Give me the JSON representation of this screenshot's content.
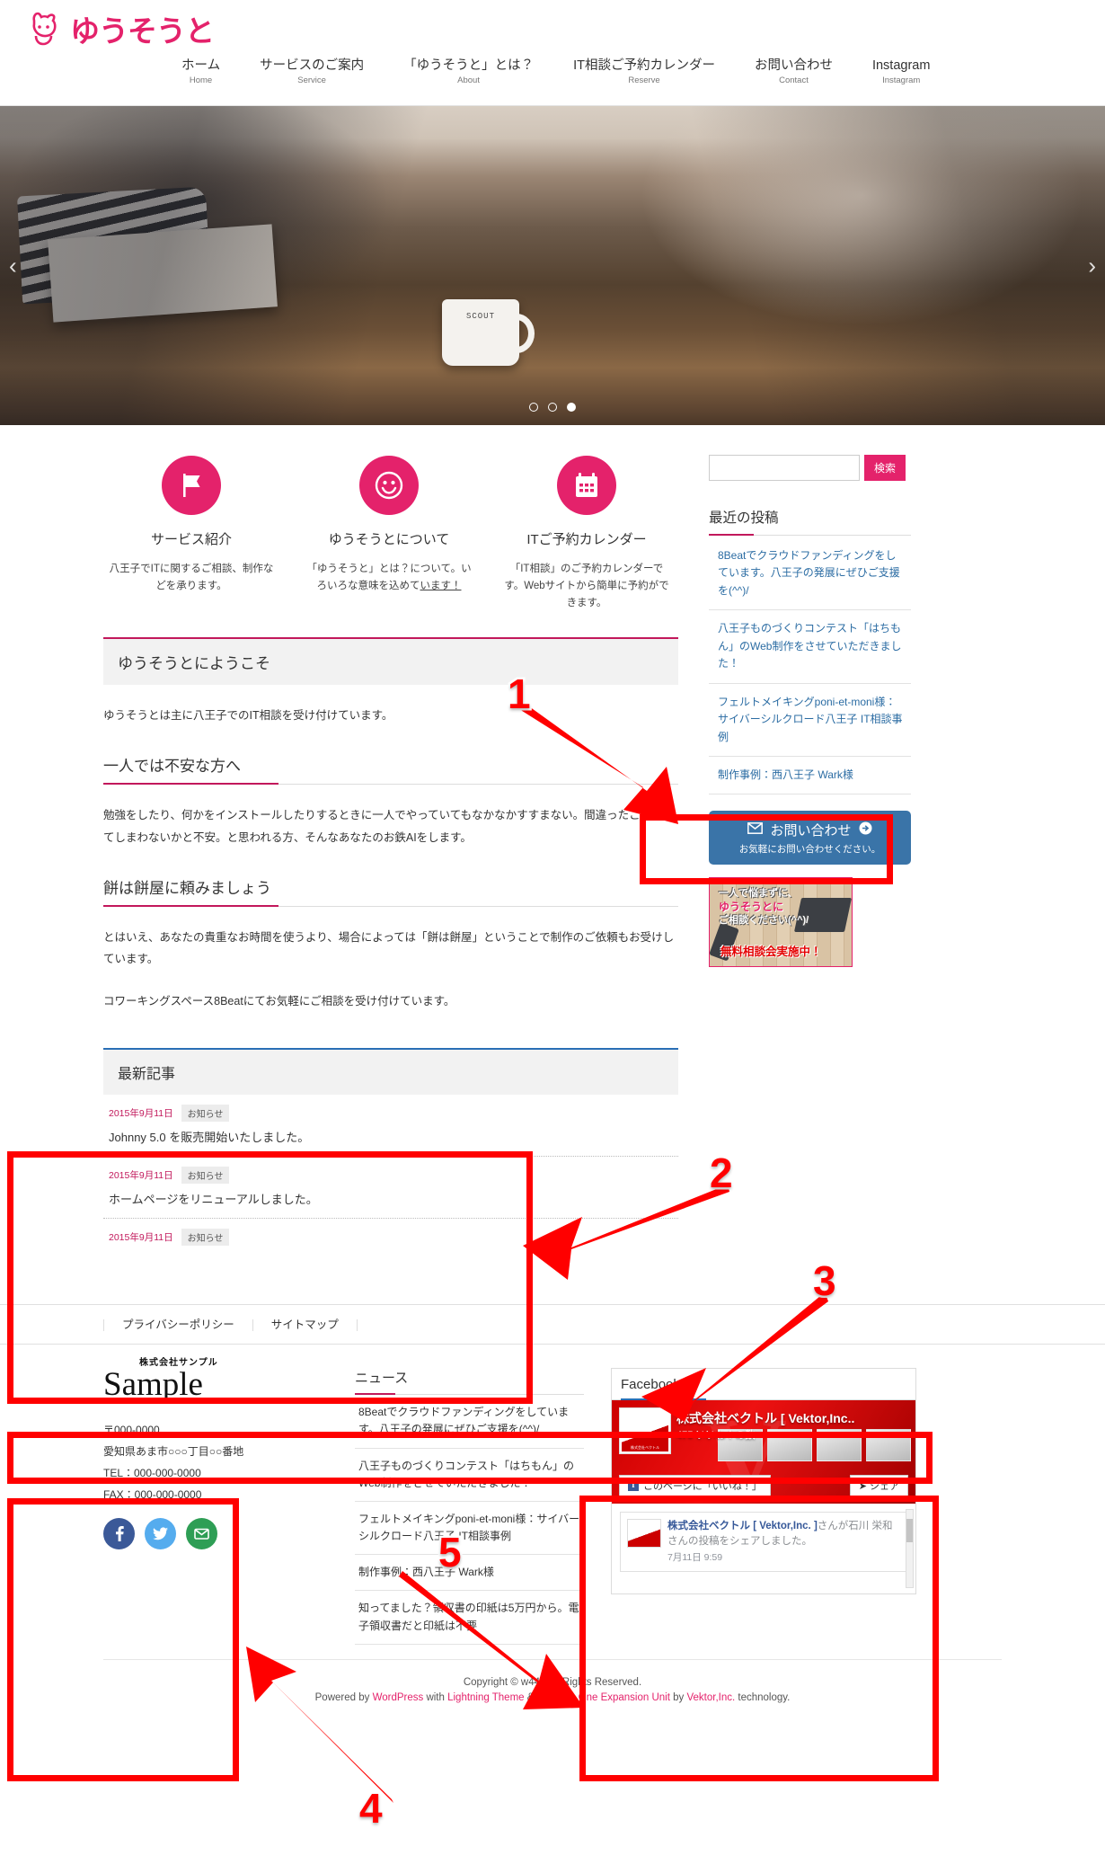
{
  "site": {
    "logo_text": "ゆうそうと",
    "brand_color": "#e4226b"
  },
  "nav": [
    {
      "ja": "ホーム",
      "en": "Home"
    },
    {
      "ja": "サービスのご案内",
      "en": "Service"
    },
    {
      "ja": "「ゆうそうと」とは？",
      "en": "About"
    },
    {
      "ja": "IT相談ご予約カレンダー",
      "en": "Reserve"
    },
    {
      "ja": "お問い合わせ",
      "en": "Contact"
    },
    {
      "ja": "Instagram",
      "en": "Instagram"
    }
  ],
  "hero": {
    "prev": "‹",
    "next": "›",
    "mug_label": "SCOUT",
    "dots": 3,
    "active_dot": 3
  },
  "features": [
    {
      "icon": "flag-icon",
      "title": "サービス紹介",
      "desc": "八王子でITに関するご相談、制作などを承ります。",
      "link_text": ""
    },
    {
      "icon": "smiley-icon",
      "title": "ゆうそうとについて",
      "desc": "「ゆうそうと」とは？について。いろいろな意味を込めて",
      "link_text": "います！"
    },
    {
      "icon": "calendar-icon",
      "title": "ITご予約カレンダー",
      "desc": "「IT相談」のご予約カレンダーです。Webサイトから簡単に予約ができます。",
      "link_text": ""
    }
  ],
  "main": {
    "section_title": "ゆうそうとにようこそ",
    "intro": "ゆうそうとは主に八王子でのIT相談を受け付けています。",
    "h3_1": "一人では不安な方へ",
    "p1": "勉強をしたり、何かをインストールしたりするときに一人でやっていてもなかなかすすまない。間違ったことをしてしまわないかと不安。と思われる方、そんなあなたのお鉄AIをします。",
    "h3_2": "餅は餅屋に頼みましょう",
    "p2": "とはいえ、あなたの貴重なお時間を使うより、場合によっては「餅は餅屋」ということで制作のご依頼もお受けしています。",
    "p3": "コワーキングスペース8Beatにてお気軽にご相談を受け付けています。"
  },
  "latest": {
    "heading": "最新記事",
    "items": [
      {
        "date": "2015年9月11日",
        "cat": "お知らせ",
        "title": "Johnny 5.0 を販売開始いたしました。"
      },
      {
        "date": "2015年9月11日",
        "cat": "お知らせ",
        "title": "ホームページをリニューアルしました。"
      },
      {
        "date": "2015年9月11日",
        "cat": "お知らせ",
        "title": ""
      }
    ]
  },
  "sidebar": {
    "search_placeholder": "",
    "search_value": "",
    "search_button": "検索",
    "recent_heading": "最近の投稿",
    "recent_posts": [
      "8Beatでクラウドファンディングをしています。八王子の発展にぜひご支援を(^^)/",
      "八王子ものづくりコンテスト「はちもん」のWeb制作をさせていただきました！",
      "フェルトメイキングponi-et-moni様：サイバーシルクロード八王子 IT相談事例",
      "制作事例：西八王子 Wark様"
    ],
    "contact_main": "お問い合わせ",
    "contact_sub": "お気軽にお問い合わせください。",
    "banner": {
      "line1": "一人で悩まずに、",
      "line2": "ゆうそうとに",
      "line3": "ご相談ください(^^)/",
      "line4": "無料相談会実施中！"
    }
  },
  "subnav": [
    "プライバシーポリシー",
    "サイトマップ"
  ],
  "footer": {
    "company_kana": "株式会社サンプル",
    "company_name": "Sample",
    "zip": "〒000-0000",
    "address": "愛知県あま市○○○丁目○○番地",
    "tel": "TEL：000-000-0000",
    "fax": "FAX：000-000-0000",
    "sns": [
      {
        "name": "facebook-icon",
        "color": "#3b5998"
      },
      {
        "name": "twitter-icon",
        "color": "#55acee"
      },
      {
        "name": "mail-icon",
        "color": "#2e9e55"
      }
    ],
    "news_heading": "ニュース",
    "news": [
      "8Beatでクラウドファンディングをしています。八王子の発展にぜひご支援を(^^)/",
      "八王子ものづくりコンテスト「はちもん」のWeb制作をさせていただきました！",
      "フェルトメイキングponi-et-moni様：サイバーシルクロード八王子 IT相談事例",
      "制作事例：西八王子 Wark様",
      "知ってました？領収書の印紙は5万円から。電子領収書だと印紙は不要"
    ],
    "facebook": {
      "heading": "Facebook",
      "page_name": "株式会社ベクトル [ Vektor,Inc..",
      "likes": "475 いいね！の数",
      "like_button": "このページに「いいね！」",
      "share_button": "シェア",
      "post_author": "株式会社ベクトル [ Vektor,Inc. ]",
      "post_text": "さんが石川 栄和さんの投稿をシェアしました。",
      "post_time": "7月11日 9:59"
    },
    "copyright": "Copyright © w442 All Rights Reserved.",
    "powered": {
      "pre": "Powered by ",
      "wordpress": "WordPress",
      "mid1": " with ",
      "lightning": "Lightning Theme",
      "amp": " & ",
      "vkaio": "VK All in One Expansion Unit",
      "mid2": " by ",
      "vektor": "Vektor,Inc.",
      "post": " technology."
    }
  },
  "annotations": [
    {
      "label": "1"
    },
    {
      "label": "2"
    },
    {
      "label": "3"
    },
    {
      "label": "4"
    },
    {
      "label": "5"
    }
  ]
}
